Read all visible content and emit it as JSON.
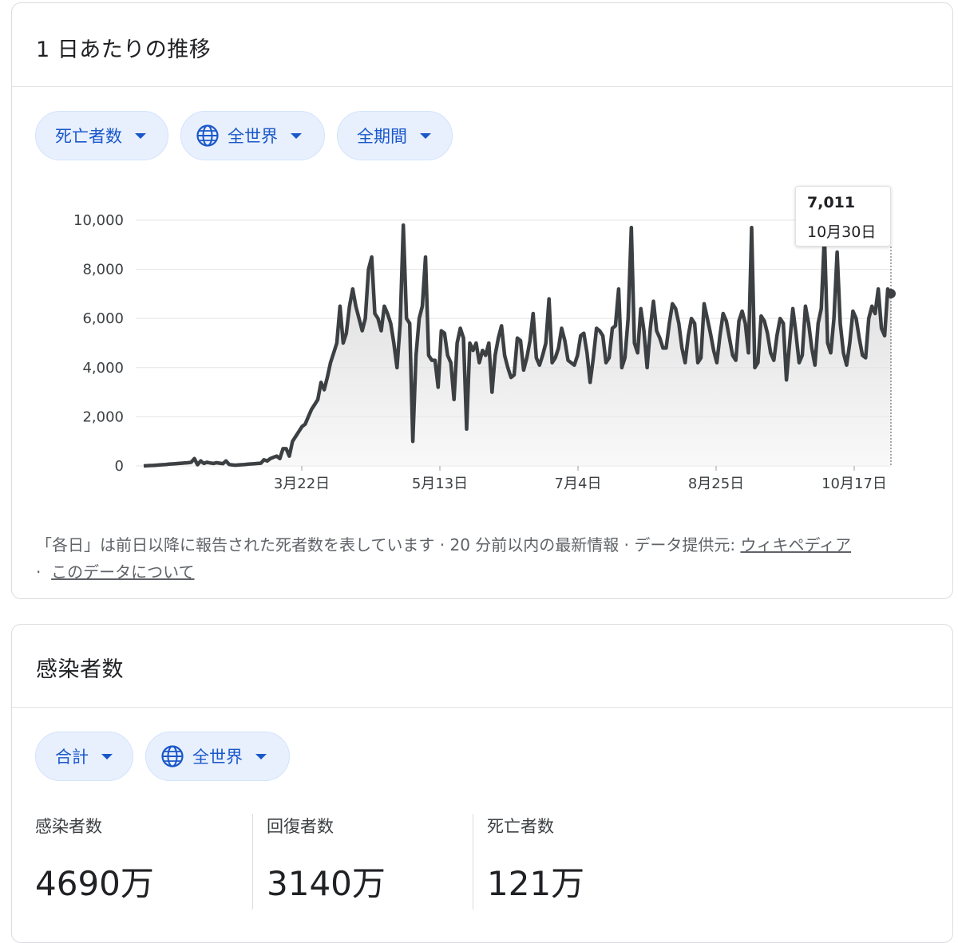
{
  "trend_card": {
    "title": "1 日あたりの推移",
    "filters": [
      {
        "label": "死亡者数",
        "icon": null
      },
      {
        "label": "全世界",
        "icon": "globe-icon"
      },
      {
        "label": "全期間",
        "icon": null
      }
    ],
    "tooltip": {
      "value": "7,011",
      "date": "10月30日"
    },
    "footnote": {
      "text": "「各日」は前日以降に報告された死者数を表しています · 20 分前以内の最新情報 · データ提供元: ",
      "source_link": "ウィキペディア",
      "separator": "·",
      "about_link": "このデータについて"
    }
  },
  "chart_data": {
    "type": "area",
    "title": "",
    "xlabel": "",
    "ylabel": "",
    "ylim": [
      0,
      10000
    ],
    "y_ticks": [
      "10,000",
      "8,000",
      "6,000",
      "4,000",
      "2,000",
      "0"
    ],
    "x_tick_labels": [
      "3月22日",
      "5月13日",
      "7月4日",
      "8月25日",
      "10月17日"
    ],
    "x_range": [
      "1月22日",
      "10月31日"
    ],
    "highlight_point": {
      "date": "10月30日",
      "value": 7011
    },
    "series": [
      {
        "color": "#3c4043",
        "values": [
          0,
          10,
          15,
          20,
          30,
          40,
          50,
          60,
          70,
          80,
          90,
          100,
          110,
          120,
          130,
          150,
          300,
          50,
          200,
          100,
          150,
          120,
          100,
          130,
          110,
          90,
          200,
          60,
          40,
          30,
          40,
          50,
          60,
          70,
          80,
          90,
          100,
          110,
          250,
          200,
          300,
          350,
          400,
          300,
          700,
          700,
          400,
          1000,
          1200,
          1400,
          1600,
          1700,
          2000,
          2300,
          2500,
          2700,
          3400,
          3100,
          3600,
          4200,
          4600,
          5000,
          6500,
          5000,
          5400,
          6500,
          7200,
          6500,
          6000,
          5500,
          6000,
          8000,
          8500,
          6200,
          6000,
          5500,
          6500,
          6200,
          5800,
          5000,
          4000,
          5800,
          9800,
          6000,
          5800,
          1000,
          4500,
          6000,
          6500,
          8500,
          4500,
          4300,
          4300,
          3200,
          5500,
          5400,
          4500,
          4200,
          2700,
          5000,
          5600,
          5200,
          1500,
          5000,
          4700,
          5000,
          4200,
          4700,
          4500,
          5000,
          3000,
          4500,
          5200,
          5700,
          4500,
          4000,
          3600,
          3700,
          5200,
          5100,
          3900,
          4400,
          5100,
          6200,
          4400,
          4100,
          4500,
          5000,
          6800,
          4200,
          4400,
          4800,
          5600,
          5100,
          4300,
          4200,
          4100,
          4500,
          5300,
          5400,
          4600,
          3400,
          4400,
          5600,
          5500,
          5300,
          4200,
          4400,
          5600,
          5700,
          7200,
          4000,
          4400,
          6000,
          9700,
          5000,
          4600,
          6400,
          5500,
          4000,
          5600,
          6700,
          5500,
          5200,
          4800,
          4800,
          5800,
          6600,
          6400,
          5800,
          4800,
          4200,
          5300,
          6000,
          5800,
          4200,
          4400,
          6600,
          6000,
          5400,
          4700,
          4200,
          5300,
          6200,
          5900,
          5200,
          4500,
          4300,
          5900,
          6300,
          5800,
          4600,
          9700,
          4000,
          4200,
          6100,
          5900,
          5400,
          4600,
          4300,
          5300,
          6000,
          5800,
          3500,
          5000,
          6400,
          5400,
          4200,
          4500,
          6500,
          5800,
          4800,
          4100,
          5800,
          6400,
          9400,
          5000,
          4600,
          6000,
          8700,
          5800,
          4600,
          4100,
          5000,
          6300,
          6000,
          5200,
          4500,
          4400,
          6000,
          6500,
          6200,
          7200,
          5600,
          5300,
          7200,
          7011
        ]
      }
    ]
  },
  "cases_card": {
    "title": "感染者数",
    "filters": [
      {
        "label": "合計",
        "icon": null
      },
      {
        "label": "全世界",
        "icon": "globe-icon"
      }
    ],
    "stats": [
      {
        "label": "感染者数",
        "value": "4690万"
      },
      {
        "label": "回復者数",
        "value": "3140万"
      },
      {
        "label": "死亡者数",
        "value": "121万"
      }
    ]
  },
  "colors": {
    "chip_bg": "#e8f0fe",
    "chip_text": "#1a57c9",
    "line": "#3c4043"
  }
}
